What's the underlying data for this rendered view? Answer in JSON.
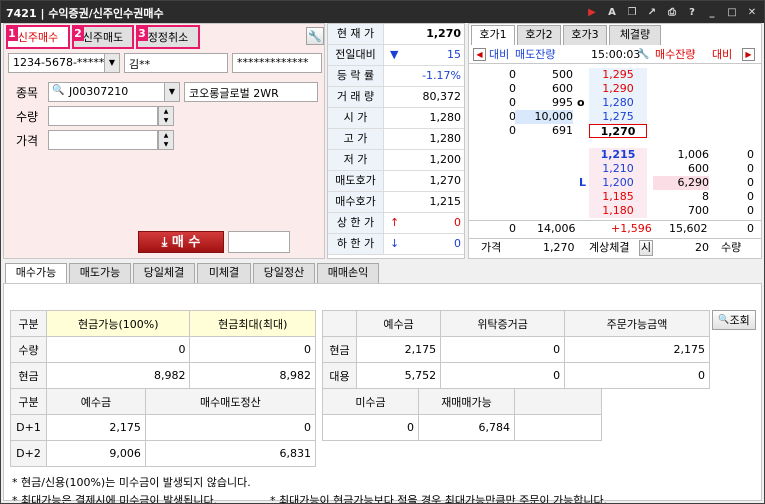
{
  "window": {
    "code": "7421",
    "title": "수익증권/신주인수권매수"
  },
  "top_tabs": [
    {
      "num": "1",
      "label": "신주매수"
    },
    {
      "num": "2",
      "label": "신주매도"
    },
    {
      "num": "3",
      "label": "정정취소"
    }
  ],
  "account": {
    "number": "1234-5678-*****",
    "name": "김**",
    "password": "*************"
  },
  "form": {
    "symbol_label": "종목",
    "symbol_code": "J00307210",
    "symbol_name": "코오롱글로벌 2WR",
    "qty_label": "수량",
    "price_label": "가격",
    "buy_button": "매 수"
  },
  "quote": [
    {
      "k": "현 재 가",
      "v": "1,270",
      "c": ""
    },
    {
      "k": "전일대비",
      "v": "15",
      "c": "blue",
      "arrow": "▼"
    },
    {
      "k": "등 락 률",
      "v": "-1.17%",
      "c": "blue"
    },
    {
      "k": "거 래 량",
      "v": "80,372",
      "c": ""
    },
    {
      "k": "시   가",
      "v": "1,280",
      "c": ""
    },
    {
      "k": "고   가",
      "v": "1,280",
      "c": ""
    },
    {
      "k": "저   가",
      "v": "1,200",
      "c": ""
    },
    {
      "k": "매도호가",
      "v": "1,270",
      "c": ""
    },
    {
      "k": "매수호가",
      "v": "1,215",
      "c": ""
    },
    {
      "k": "상 한 가",
      "v": "0",
      "c": "red",
      "arrow": "↑"
    },
    {
      "k": "하 한 가",
      "v": "0",
      "c": "blue",
      "arrow": "↓"
    }
  ],
  "hoga_tabs": [
    "호가1",
    "호가2",
    "호가3",
    "체결량"
  ],
  "hoga_head": {
    "left": "대비",
    "left2": "매도잔량",
    "time": "15:00:03",
    "right": "매수잔량",
    "right2": "대비"
  },
  "asks": [
    {
      "chg": "0",
      "qty": "500",
      "price": "1,295"
    },
    {
      "chg": "0",
      "qty": "600",
      "price": "1,290"
    },
    {
      "chg": "0",
      "qty": "995",
      "price": "1,280",
      "mark": "o"
    },
    {
      "chg": "0",
      "qty": "10,000",
      "price": "1,275"
    },
    {
      "chg": "0",
      "qty": "691",
      "price": "1,270"
    }
  ],
  "bids": [
    {
      "price": "1,215",
      "qty": "1,006",
      "chg": "0"
    },
    {
      "price": "1,210",
      "qty": "600",
      "chg": "0"
    },
    {
      "price": "1,200",
      "qty": "6,290",
      "chg": "0",
      "mark": "L"
    },
    {
      "price": "1,185",
      "qty": "8",
      "chg": "0"
    },
    {
      "price": "1,180",
      "qty": "700",
      "chg": "0"
    }
  ],
  "hoga_total": {
    "ask_chg": "0",
    "ask_qty": "14,006",
    "diff": "+1,596",
    "bid_qty": "15,602",
    "bid_chg": "0"
  },
  "hoga_footer": {
    "price_label": "가격",
    "price": "1,270",
    "calc_label": "계상체결",
    "calc_btn": "시",
    "qty": "20",
    "qty_label": "수량"
  },
  "bottom_tabs": [
    "매수가능",
    "매도가능",
    "당일체결",
    "미체결",
    "당일정산",
    "매매손익"
  ],
  "t1": {
    "h": [
      "구분",
      "현금가능(100%)",
      "현금최대(최대)"
    ],
    "rows": [
      [
        "수량",
        "0",
        "0"
      ],
      [
        "현금",
        "8,982",
        "8,982"
      ]
    ]
  },
  "t2": {
    "h": [
      "",
      "예수금",
      "위탁증거금",
      "주문가능금액"
    ],
    "rows": [
      [
        "현금",
        "2,175",
        "0",
        "2,175"
      ],
      [
        "대용",
        "5,752",
        "0",
        "0"
      ]
    ]
  },
  "lookup_btn": "조회",
  "t3": {
    "h": [
      "구분",
      "예수금",
      "매수매도정산"
    ],
    "rows": [
      [
        "D+1",
        "2,175",
        "0"
      ],
      [
        "D+2",
        "9,006",
        "6,831"
      ]
    ]
  },
  "t4": {
    "h": [
      "미수금",
      "재매매가능"
    ],
    "row": [
      "0",
      "6,784"
    ]
  },
  "notes": [
    "* 현금/신용(100%)는 미수금이 발생되지 않습니다.",
    "* 최대가능은 결제시에 미수금이 발생됩니다.",
    "* 최대가능이 현금가능보다 적을 경우 최대가능만큼만 주문이 가능합니다."
  ]
}
